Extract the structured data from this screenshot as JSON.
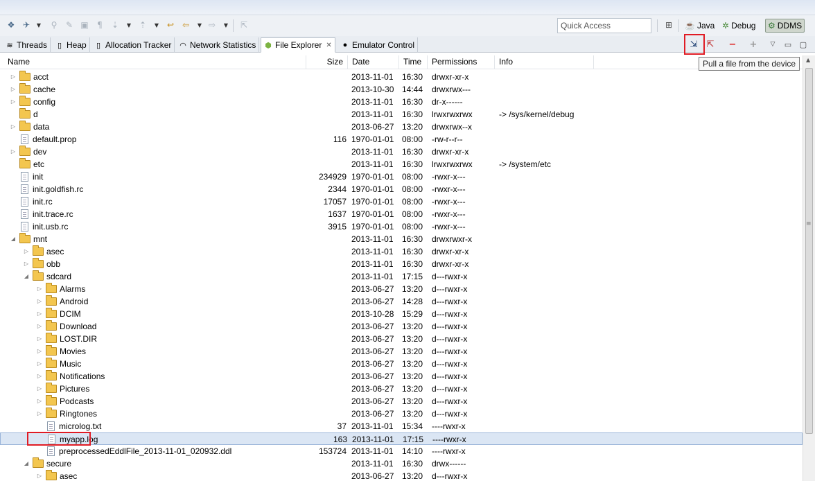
{
  "toolbar": {
    "quick_access_placeholder": "Quick Access",
    "perspectives": [
      {
        "label": "Java",
        "icon": "java-perspective-icon"
      },
      {
        "label": "Debug",
        "icon": "debug-perspective-icon"
      },
      {
        "label": "DDMS",
        "icon": "ddms-perspective-icon",
        "active": true
      }
    ]
  },
  "tabs": [
    {
      "label": "Threads",
      "icon": "threads-icon"
    },
    {
      "label": "Heap",
      "icon": "heap-icon"
    },
    {
      "label": "Allocation Tracker",
      "icon": "allocation-tracker-icon"
    },
    {
      "label": "Network Statistics",
      "icon": "network-icon"
    },
    {
      "label": "File Explorer",
      "icon": "android-icon",
      "active": true,
      "close": "✕"
    },
    {
      "label": "Emulator Control",
      "icon": "emulator-icon"
    }
  ],
  "tooltip": "Pull a file from the device",
  "columns": {
    "name": "Name",
    "size": "Size",
    "date": "Date",
    "time": "Time",
    "permissions": "Permissions",
    "info": "Info"
  },
  "rows": [
    {
      "name": "acct",
      "type": "folder",
      "depth": 0,
      "expander": "collapsed",
      "size": "",
      "date": "2013-11-01",
      "time": "16:30",
      "perm": "drwxr-xr-x",
      "info": ""
    },
    {
      "name": "cache",
      "type": "folder",
      "depth": 0,
      "expander": "collapsed",
      "size": "",
      "date": "2013-10-30",
      "time": "14:44",
      "perm": "drwxrwx---",
      "info": ""
    },
    {
      "name": "config",
      "type": "folder",
      "depth": 0,
      "expander": "collapsed",
      "size": "",
      "date": "2013-11-01",
      "time": "16:30",
      "perm": "dr-x------",
      "info": ""
    },
    {
      "name": "d",
      "type": "folder",
      "depth": 0,
      "expander": "none",
      "size": "",
      "date": "2013-11-01",
      "time": "16:30",
      "perm": "lrwxrwxrwx",
      "info": "-> /sys/kernel/debug"
    },
    {
      "name": "data",
      "type": "folder",
      "depth": 0,
      "expander": "collapsed",
      "size": "",
      "date": "2013-06-27",
      "time": "13:20",
      "perm": "drwxrwx--x",
      "info": ""
    },
    {
      "name": "default.prop",
      "type": "file",
      "depth": 0,
      "expander": "none",
      "size": "116",
      "date": "1970-01-01",
      "time": "08:00",
      "perm": "-rw-r--r--",
      "info": ""
    },
    {
      "name": "dev",
      "type": "folder",
      "depth": 0,
      "expander": "collapsed",
      "size": "",
      "date": "2013-11-01",
      "time": "16:30",
      "perm": "drwxr-xr-x",
      "info": ""
    },
    {
      "name": "etc",
      "type": "folder",
      "depth": 0,
      "expander": "none",
      "size": "",
      "date": "2013-11-01",
      "time": "16:30",
      "perm": "lrwxrwxrwx",
      "info": "-> /system/etc"
    },
    {
      "name": "init",
      "type": "file",
      "depth": 0,
      "expander": "none",
      "size": "234929",
      "date": "1970-01-01",
      "time": "08:00",
      "perm": "-rwxr-x---",
      "info": ""
    },
    {
      "name": "init.goldfish.rc",
      "type": "file",
      "depth": 0,
      "expander": "none",
      "size": "2344",
      "date": "1970-01-01",
      "time": "08:00",
      "perm": "-rwxr-x---",
      "info": ""
    },
    {
      "name": "init.rc",
      "type": "file",
      "depth": 0,
      "expander": "none",
      "size": "17057",
      "date": "1970-01-01",
      "time": "08:00",
      "perm": "-rwxr-x---",
      "info": ""
    },
    {
      "name": "init.trace.rc",
      "type": "file",
      "depth": 0,
      "expander": "none",
      "size": "1637",
      "date": "1970-01-01",
      "time": "08:00",
      "perm": "-rwxr-x---",
      "info": ""
    },
    {
      "name": "init.usb.rc",
      "type": "file",
      "depth": 0,
      "expander": "none",
      "size": "3915",
      "date": "1970-01-01",
      "time": "08:00",
      "perm": "-rwxr-x---",
      "info": ""
    },
    {
      "name": "mnt",
      "type": "folder",
      "depth": 0,
      "expander": "expanded",
      "size": "",
      "date": "2013-11-01",
      "time": "16:30",
      "perm": "drwxrwxr-x",
      "info": ""
    },
    {
      "name": "asec",
      "type": "folder",
      "depth": 1,
      "expander": "collapsed",
      "size": "",
      "date": "2013-11-01",
      "time": "16:30",
      "perm": "drwxr-xr-x",
      "info": ""
    },
    {
      "name": "obb",
      "type": "folder",
      "depth": 1,
      "expander": "collapsed",
      "size": "",
      "date": "2013-11-01",
      "time": "16:30",
      "perm": "drwxr-xr-x",
      "info": ""
    },
    {
      "name": "sdcard",
      "type": "folder",
      "depth": 1,
      "expander": "expanded",
      "size": "",
      "date": "2013-11-01",
      "time": "17:15",
      "perm": "d---rwxr-x",
      "info": ""
    },
    {
      "name": "Alarms",
      "type": "folder",
      "depth": 2,
      "expander": "collapsed",
      "size": "",
      "date": "2013-06-27",
      "time": "13:20",
      "perm": "d---rwxr-x",
      "info": ""
    },
    {
      "name": "Android",
      "type": "folder",
      "depth": 2,
      "expander": "collapsed",
      "size": "",
      "date": "2013-06-27",
      "time": "14:28",
      "perm": "d---rwxr-x",
      "info": ""
    },
    {
      "name": "DCIM",
      "type": "folder",
      "depth": 2,
      "expander": "collapsed",
      "size": "",
      "date": "2013-10-28",
      "time": "15:29",
      "perm": "d---rwxr-x",
      "info": ""
    },
    {
      "name": "Download",
      "type": "folder",
      "depth": 2,
      "expander": "collapsed",
      "size": "",
      "date": "2013-06-27",
      "time": "13:20",
      "perm": "d---rwxr-x",
      "info": ""
    },
    {
      "name": "LOST.DIR",
      "type": "folder",
      "depth": 2,
      "expander": "collapsed",
      "size": "",
      "date": "2013-06-27",
      "time": "13:20",
      "perm": "d---rwxr-x",
      "info": ""
    },
    {
      "name": "Movies",
      "type": "folder",
      "depth": 2,
      "expander": "collapsed",
      "size": "",
      "date": "2013-06-27",
      "time": "13:20",
      "perm": "d---rwxr-x",
      "info": ""
    },
    {
      "name": "Music",
      "type": "folder",
      "depth": 2,
      "expander": "collapsed",
      "size": "",
      "date": "2013-06-27",
      "time": "13:20",
      "perm": "d---rwxr-x",
      "info": ""
    },
    {
      "name": "Notifications",
      "type": "folder",
      "depth": 2,
      "expander": "collapsed",
      "size": "",
      "date": "2013-06-27",
      "time": "13:20",
      "perm": "d---rwxr-x",
      "info": ""
    },
    {
      "name": "Pictures",
      "type": "folder",
      "depth": 2,
      "expander": "collapsed",
      "size": "",
      "date": "2013-06-27",
      "time": "13:20",
      "perm": "d---rwxr-x",
      "info": ""
    },
    {
      "name": "Podcasts",
      "type": "folder",
      "depth": 2,
      "expander": "collapsed",
      "size": "",
      "date": "2013-06-27",
      "time": "13:20",
      "perm": "d---rwxr-x",
      "info": ""
    },
    {
      "name": "Ringtones",
      "type": "folder",
      "depth": 2,
      "expander": "collapsed",
      "size": "",
      "date": "2013-06-27",
      "time": "13:20",
      "perm": "d---rwxr-x",
      "info": ""
    },
    {
      "name": "microlog.txt",
      "type": "file",
      "depth": 2,
      "expander": "none",
      "size": "37",
      "date": "2013-11-01",
      "time": "15:34",
      "perm": "----rwxr-x",
      "info": ""
    },
    {
      "name": "myapp.log",
      "type": "file",
      "depth": 2,
      "expander": "none",
      "size": "163",
      "date": "2013-11-01",
      "time": "17:15",
      "perm": "----rwxr-x",
      "info": "",
      "selected": true,
      "highlighted": true
    },
    {
      "name": "preprocessedEddlFile_2013-11-01_020932.ddl",
      "type": "file",
      "depth": 2,
      "expander": "none",
      "size": "153724",
      "date": "2013-11-01",
      "time": "14:10",
      "perm": "----rwxr-x",
      "info": ""
    },
    {
      "name": "secure",
      "type": "folder",
      "depth": 1,
      "expander": "expanded",
      "size": "",
      "date": "2013-11-01",
      "time": "16:30",
      "perm": "drwx------",
      "info": ""
    },
    {
      "name": "asec",
      "type": "folder",
      "depth": 2,
      "expander": "collapsed",
      "size": "",
      "date": "2013-06-27",
      "time": "13:20",
      "perm": "d---rwxr-x",
      "info": ""
    }
  ],
  "colors": {
    "highlight": "#e01b24",
    "selection": "#dbe6f4",
    "folder": "#f3c64f"
  }
}
